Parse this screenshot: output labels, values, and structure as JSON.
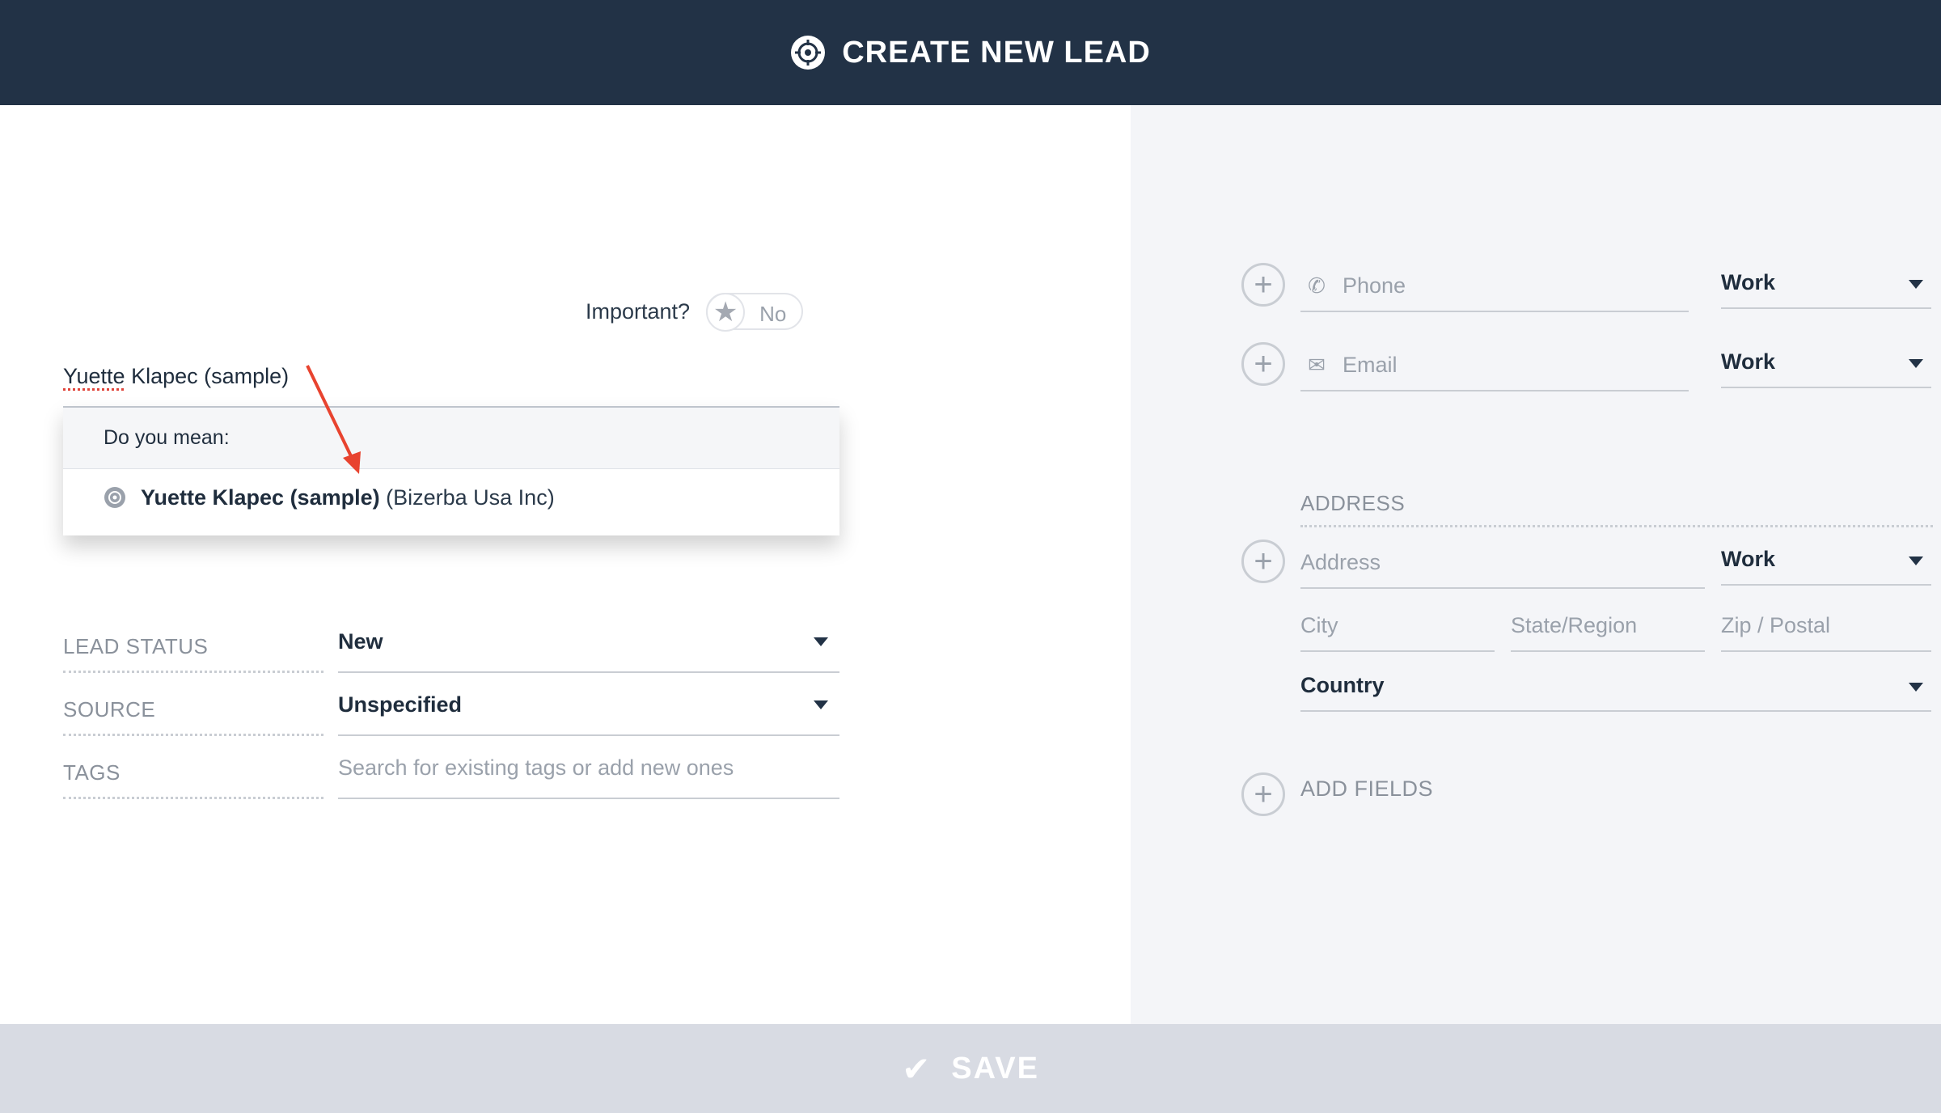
{
  "header": {
    "title": "CREATE NEW LEAD",
    "icon": "target-icon"
  },
  "important": {
    "label": "Important?",
    "value": "No"
  },
  "name": {
    "first": "Yuette",
    "rest": "Klapec (sample)"
  },
  "suggestion": {
    "heading": "Do you mean:",
    "item_name": "Yuette Klapec (sample)",
    "item_company": "(Bizerba Usa Inc)"
  },
  "fields": {
    "lead_status": {
      "label": "LEAD STATUS",
      "value": "New"
    },
    "source": {
      "label": "SOURCE",
      "value": "Unspecified"
    },
    "tags": {
      "label": "TAGS",
      "placeholder": "Search for existing tags or add new ones"
    }
  },
  "contact": {
    "phone": {
      "placeholder": "Phone",
      "type": "Work"
    },
    "email": {
      "placeholder": "Email",
      "type": "Work"
    }
  },
  "address": {
    "section_title": "ADDRESS",
    "address_placeholder": "Address",
    "type": "Work",
    "city_placeholder": "City",
    "state_placeholder": "State/Region",
    "zip_placeholder": "Zip / Postal",
    "country": "Country"
  },
  "add_fields_label": "ADD FIELDS",
  "footer": {
    "save_label": "SAVE"
  },
  "colors": {
    "header_bg": "#223246",
    "panel_bg": "#f4f5f8",
    "footer_bg": "#d8dbe3",
    "annotation_arrow": "#e8432f"
  }
}
